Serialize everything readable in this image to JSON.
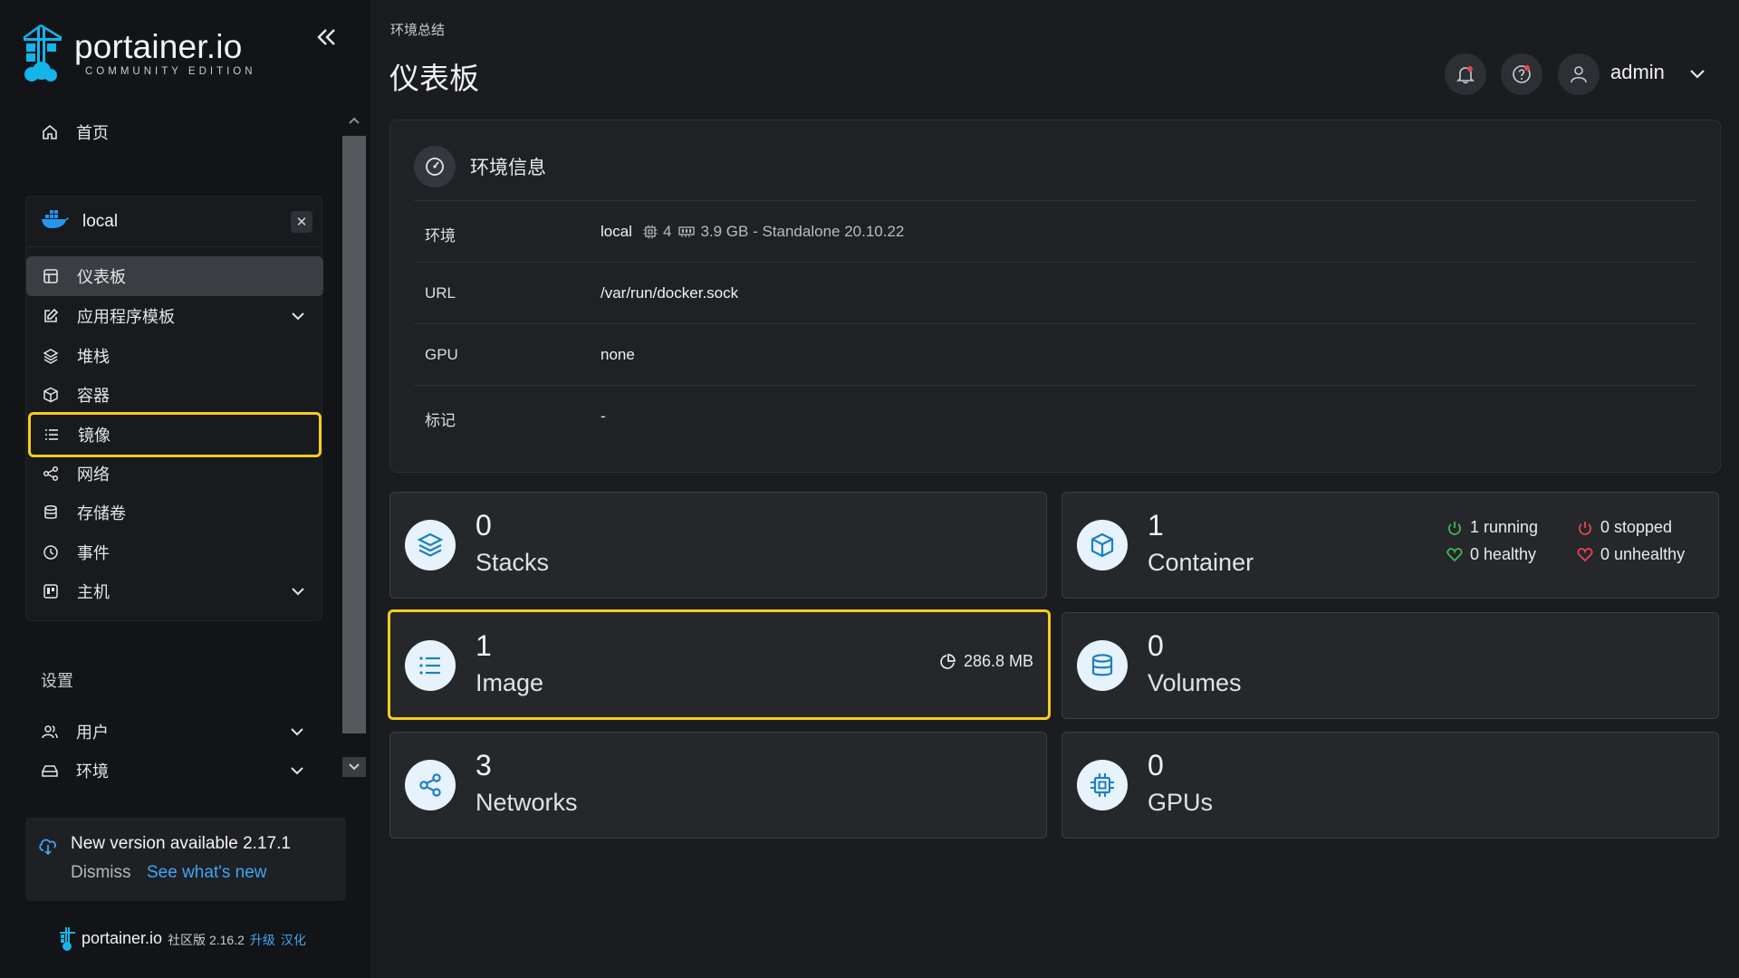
{
  "sidebar": {
    "brand": "portainer.io",
    "edition": "COMMUNITY EDITION",
    "home": "首页",
    "environment": {
      "name": "local",
      "close": "✕",
      "items": [
        {
          "label": "仪表板"
        },
        {
          "label": "应用程序模板"
        },
        {
          "label": "堆栈"
        },
        {
          "label": "容器"
        },
        {
          "label": "镜像"
        },
        {
          "label": "网络"
        },
        {
          "label": "存储卷"
        },
        {
          "label": "事件"
        },
        {
          "label": "主机"
        }
      ]
    },
    "settings_title": "设置",
    "settings_items": [
      {
        "label": "用户"
      },
      {
        "label": "环境"
      }
    ],
    "update": {
      "title": "New version available 2.17.1",
      "dismiss": "Dismiss",
      "link": "See what's new"
    },
    "footer": {
      "brand": "portainer.io",
      "version": "社区版 2.16.2",
      "upgrade": "升级",
      "localize": "汉化"
    }
  },
  "header": {
    "breadcrumb": "环境总结",
    "title": "仪表板",
    "user": "admin"
  },
  "env_info": {
    "title": "环境信息",
    "rows": [
      {
        "key": "环境",
        "value": "local",
        "cpu": "4",
        "memory": "3.9 GB - Standalone 20.10.22"
      },
      {
        "key": "URL",
        "value": "/var/run/docker.sock"
      },
      {
        "key": "GPU",
        "value": "none"
      },
      {
        "key": "标记",
        "value": "-"
      }
    ]
  },
  "cards": {
    "stacks": {
      "count": "0",
      "label": "Stacks"
    },
    "containers": {
      "count": "1",
      "label": "Container",
      "running": "1 running",
      "stopped": "0 stopped",
      "healthy": "0 healthy",
      "unhealthy": "0 unhealthy"
    },
    "images": {
      "count": "1",
      "label": "Image",
      "size": "286.8 MB"
    },
    "volumes": {
      "count": "0",
      "label": "Volumes"
    },
    "networks": {
      "count": "3",
      "label": "Networks"
    },
    "gpus": {
      "count": "0",
      "label": "GPUs"
    }
  },
  "colors": {
    "accent": "#3ea6f5",
    "highlight": "#f5cd1f",
    "running": "#3fb950",
    "stopped": "#e5484d"
  }
}
